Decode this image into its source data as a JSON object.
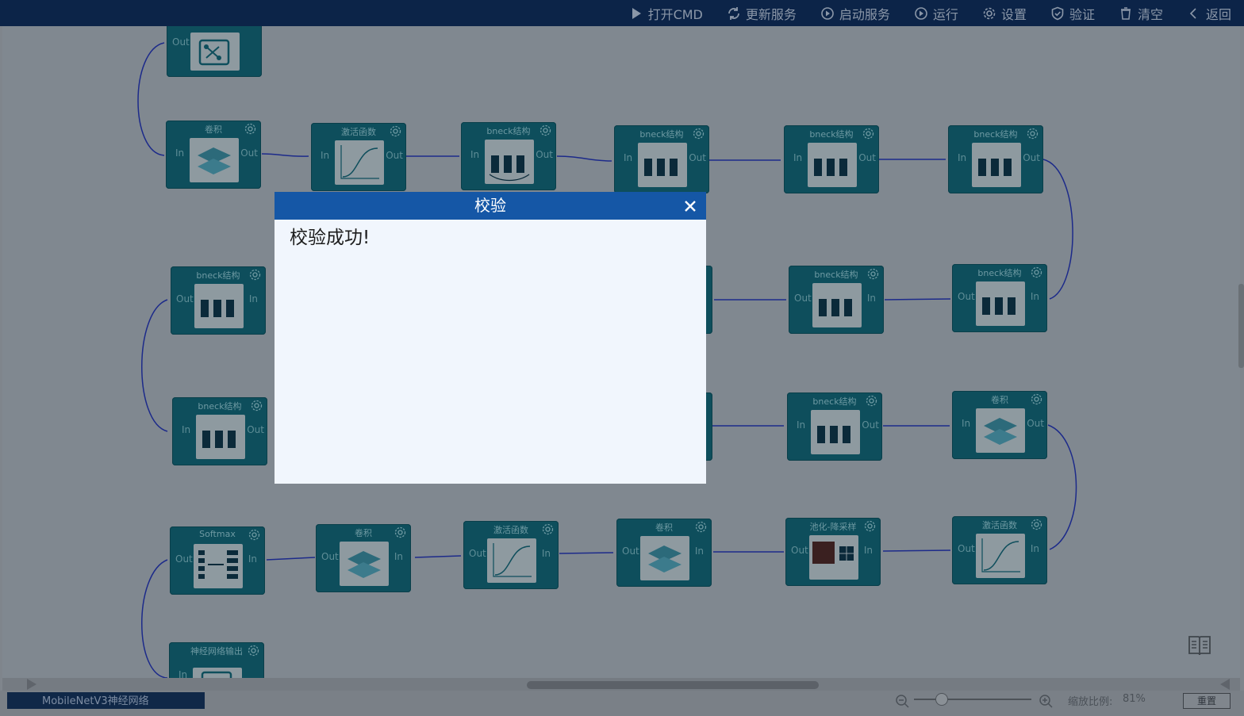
{
  "toolbar": {
    "items": [
      {
        "label": "打开CMD",
        "icon": "play-icon"
      },
      {
        "label": "更新服务",
        "icon": "refresh-icon"
      },
      {
        "label": "启动服务",
        "icon": "play-circle-icon"
      },
      {
        "label": "运行",
        "icon": "play-circle-icon"
      },
      {
        "label": "设置",
        "icon": "gear-icon"
      },
      {
        "label": "验证",
        "icon": "shield-check-icon"
      },
      {
        "label": "清空",
        "icon": "trash-icon"
      },
      {
        "label": "返回",
        "icon": "chevron-left-icon"
      }
    ]
  },
  "nodes": {
    "conv": "卷积",
    "activation": "激活函数",
    "bneck": "bneck结构",
    "pooling": "池化-降采样",
    "softmax": "Softmax",
    "output": "神经网络输出",
    "in": "In",
    "out": "Out"
  },
  "dialog": {
    "title": "校验",
    "message": "校验成功!"
  },
  "statusbar": {
    "tab_label": "MobileNetV3神经网络",
    "zoom_label": "缩放比例:",
    "zoom_value": "81%",
    "reset_label": "重置"
  },
  "colors": {
    "toolbar_bg": "#0c2448",
    "dialog_header": "#1557a6",
    "node_bg": "#0e4e5c",
    "link": "#1c2a8a"
  }
}
